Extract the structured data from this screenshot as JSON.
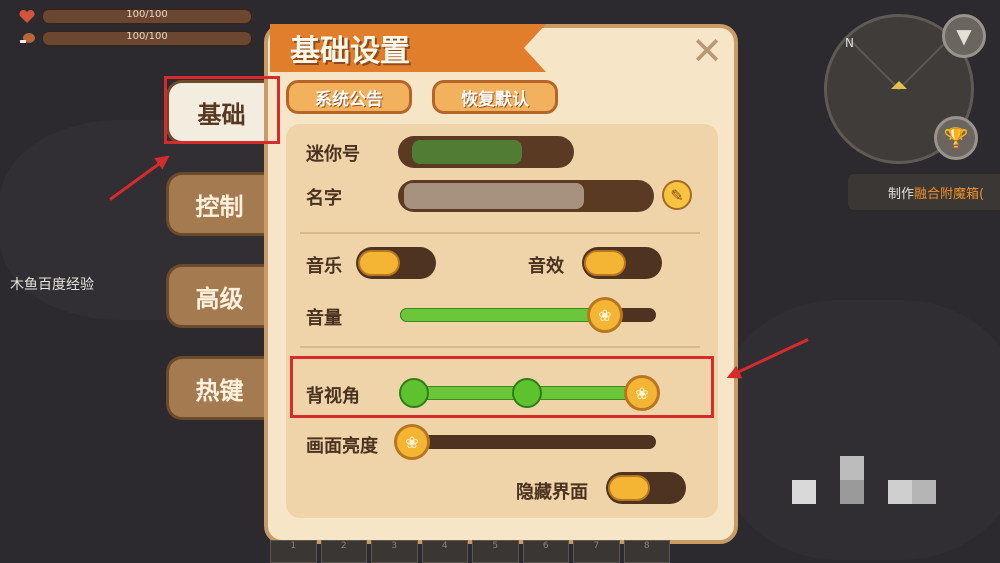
{
  "stats": {
    "health": "100/100",
    "hunger": "100/100"
  },
  "tabs": [
    {
      "label": "基础"
    },
    {
      "label": "控制"
    },
    {
      "label": "高级"
    },
    {
      "label": "热键"
    }
  ],
  "dialog": {
    "title": "基础设置",
    "buttons": {
      "announcement": "系统公告",
      "restore_default": "恢复默认"
    },
    "mini_id_label": "迷你号",
    "name_label": "名字",
    "music_label": "音乐",
    "music_on": true,
    "sfx_label": "音效",
    "sfx_on": true,
    "volume_label": "音量",
    "volume_level": 0.8,
    "back_view_label": "背视角",
    "back_view_level": 1.0,
    "brightness_label": "画面亮度",
    "brightness_level": 0.0,
    "hide_ui_label": "隐藏界面",
    "hide_ui_on": true
  },
  "hud": {
    "craft_prefix": "制作",
    "craft_item": "融合附魔箱("
  },
  "watermark": "木鱼百度经验",
  "hotbar": [
    "1",
    "2",
    "3",
    "4",
    "5",
    "6",
    "7",
    "8"
  ],
  "colors": {
    "highlight": "#d62b2b",
    "accent_orange": "#e17e2c",
    "slider_green": "#6cc63a"
  }
}
